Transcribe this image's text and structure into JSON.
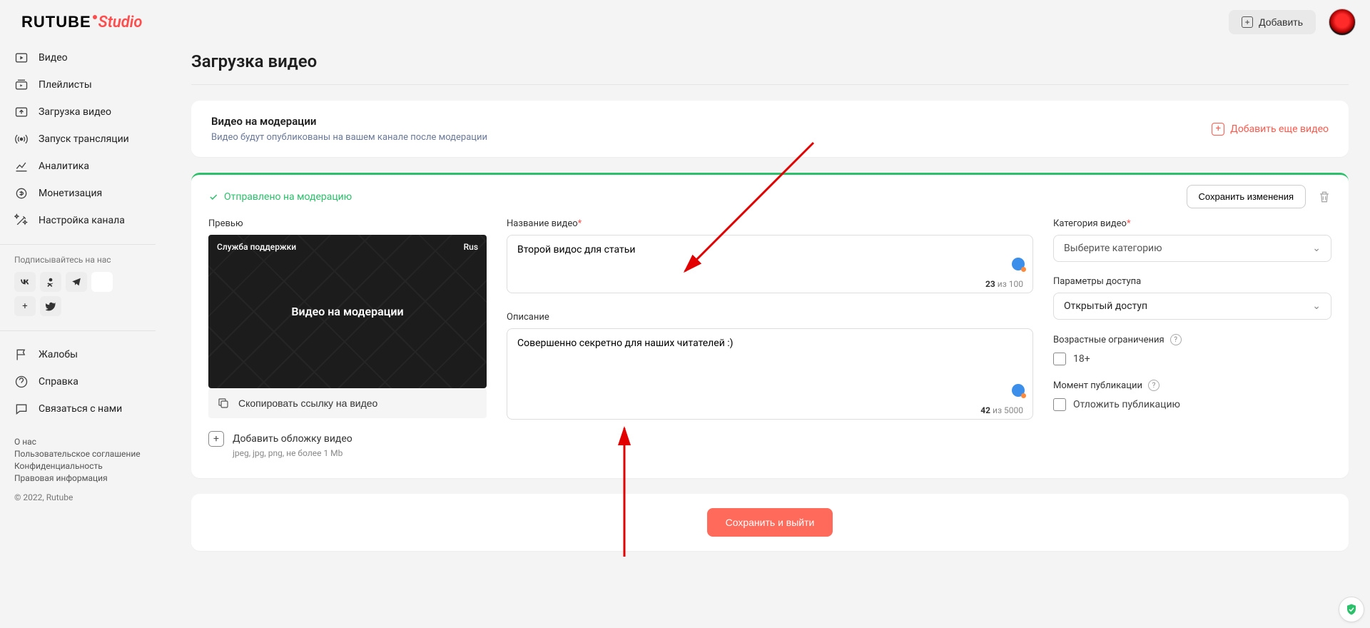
{
  "header": {
    "logo_main": "RUTUBE",
    "logo_sub": "Studio",
    "add_button": "Добавить"
  },
  "sidebar": {
    "items": [
      {
        "label": "Видео"
      },
      {
        "label": "Плейлисты"
      },
      {
        "label": "Загрузка видео"
      },
      {
        "label": "Запуск трансляции"
      },
      {
        "label": "Аналитика"
      },
      {
        "label": "Монетизация"
      },
      {
        "label": "Настройка канала"
      }
    ],
    "subscribe_title": "Подписывайтесь на нас",
    "secondary": [
      {
        "label": "Жалобы"
      },
      {
        "label": "Справка"
      },
      {
        "label": "Связаться с нами"
      }
    ],
    "footer": {
      "about": "О нас",
      "terms": "Пользовательское соглашение",
      "privacy": "Конфиденциальность",
      "legal": "Правовая информация",
      "copyright": "© 2022, Rutube"
    }
  },
  "page": {
    "title": "Загрузка видео",
    "moderation": {
      "title": "Видео на модерации",
      "subtitle": "Видео будут опубликованы на вашем канале после модерации",
      "add_more": "Добавить еще видео"
    },
    "video": {
      "status": "Отправлено на модерацию",
      "save_changes": "Сохранить изменения",
      "preview_label": "Превью",
      "thumb_overlay": "Видео на модерации",
      "thumb_tl": "Служба поддержки",
      "thumb_tr": "Rus",
      "copy_link": "Скопировать ссылку на видео",
      "add_cover": "Добавить обложку видео",
      "add_cover_hint": "jpeg, jpg, png, не более 1 Mb",
      "title_label": "Название видео",
      "title_value": "Второй видос для статьи",
      "title_count": "23",
      "title_max": "из 100",
      "desc_label": "Описание",
      "desc_value": "Совершенно секретно для наших читателей :)",
      "desc_count": "42",
      "desc_max": "из 5000",
      "category_label": "Категория видео",
      "category_placeholder": "Выберите категорию",
      "access_label": "Параметры доступа",
      "access_value": "Открытый доступ",
      "age_label": "Возрастные ограничения",
      "age_checkbox": "18+",
      "moment_label": "Момент публикации",
      "moment_checkbox": "Отложить публикацию"
    },
    "save_exit": "Сохранить и выйти"
  }
}
